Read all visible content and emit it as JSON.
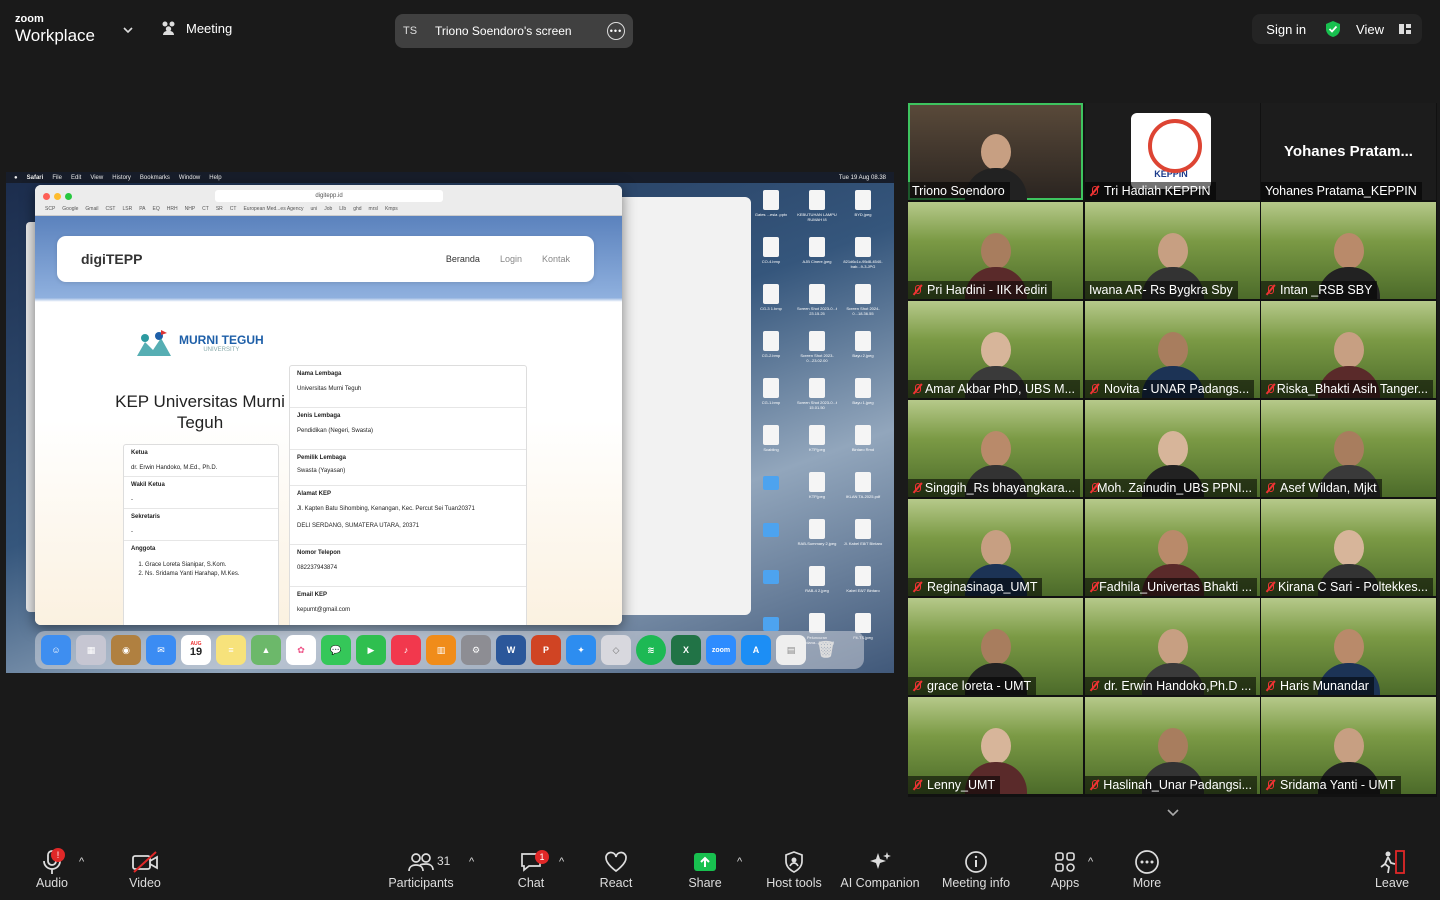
{
  "topbar": {
    "logo_line1": "zoom",
    "logo_line2": "Workplace",
    "meeting_label": "Meeting",
    "share_initials": "TS",
    "share_title": "Triono Soendoro's screen",
    "sign_in": "Sign in",
    "view": "View"
  },
  "shared_screen": {
    "menubar": [
      "Safari",
      "File",
      "Edit",
      "View",
      "History",
      "Bookmarks",
      "Window",
      "Help"
    ],
    "clock": "Tue 19 Aug 08.38",
    "url": "digitepp.id",
    "bookmarks": [
      "SCP",
      "Google",
      "Gmail",
      "CST",
      "LSR",
      "PA",
      "EQ",
      "HRH",
      "NHP",
      "CT",
      "SR",
      "CT",
      "European Med...es Agency",
      "uni",
      "Job",
      "LIb",
      "ghd",
      "mrsl",
      "Kmps"
    ],
    "site": {
      "brand": "digiTEPP",
      "nav": [
        "Beranda",
        "Login",
        "Kontak"
      ],
      "org_logo": "MURNI TEGUH",
      "org_logo_sub": "UNIVERSITY",
      "title": "KEP Universitas Murni Teguh",
      "left_fields": [
        {
          "k": "Ketua",
          "v": "dr. Erwin Handoko, M.Ed., Ph.D."
        },
        {
          "k": "Wakil Ketua",
          "v": "-"
        },
        {
          "k": "Sekretaris",
          "v": "-"
        }
      ],
      "anggota_label": "Anggota",
      "anggota": [
        "Grace Loreta Sianipar, S.Kom.",
        "Ns. Sridama Yanti Harahap, M.Kes."
      ],
      "right_fields": [
        {
          "k": "Nama Lembaga",
          "v": "Universitas Murni Teguh"
        },
        {
          "k": "Jenis Lembaga",
          "v": "Pendidikan (Negeri, Swasta)"
        },
        {
          "k": "Pemilik Lembaga",
          "v": "Swasta (Yayasan)"
        },
        {
          "k": "Alamat KEP",
          "v": "Jl. Kapten Batu Sihombing, Kenangan, Kec. Percut Sei Tuan20371",
          "v2": "DELI SERDANG, SUMATERA UTARA, 20371"
        },
        {
          "k": "Nomor Telepon",
          "v": "082237943874"
        },
        {
          "k": "Email KEP",
          "v": "kepumt@gmail.com"
        }
      ]
    },
    "desktop_icons": [
      "Gates ...esia .pptx",
      "KEBUTUHAN LAMPU RUMAH I8",
      "BYD.jpeg",
      "CO-4.bmp",
      "AJB Cinere.jpeg",
      "821d6c1c-95d8-4540-bab...9-3.JPG",
      "CG-3 1.bmp",
      "Screen Shot 2023-0...t 23.15.25",
      "Screen Shot 2024-0...18.36.55",
      "CG-2.bmp",
      "Screen Shot 2023-0...23.02.00",
      "Bayu 2.jpeg",
      "CG-1.bmp",
      "Screen Shot 2023-0...t 15.01.50",
      "Bayu 1.jpeg",
      "Scabling",
      "KTP.jpeg",
      "Bintaro Rmd",
      "",
      "KTP.jpeg",
      "IKLAN TA-2025.pdf",
      "",
      "RAB-Summary 2.jpeg",
      "Jl. Kabel E8/7 Bintaro",
      "",
      "RAB-4 2.jpeg",
      "Kabel E8/7 Bintaro",
      "",
      "Peluncuran Perdana...2022.pdf",
      "Fit-TS.jpeg"
    ],
    "dock_date": "19",
    "dock_month": "AUG"
  },
  "gallery": {
    "tiles": [
      {
        "name": "Triono Soendoro",
        "muted": false,
        "active": true
      },
      {
        "name": "Tri Hadiah KEPPIN",
        "muted": true,
        "logo": "KEPPIN"
      },
      {
        "name": "Yohanes Pratama_KEPPIN",
        "muted": false,
        "bigname": "Yohanes  Pratam..."
      },
      {
        "name": "Pri Hardini - IIK Kediri",
        "muted": true
      },
      {
        "name": "Iwana AR- Rs Bygkra Sby",
        "muted": false
      },
      {
        "name": "Intan _RSB SBY",
        "muted": true
      },
      {
        "name": "Amar Akbar PhD, UBS M...",
        "muted": true
      },
      {
        "name": "Novita - UNAR Padangs...",
        "muted": true
      },
      {
        "name": "Riska_Bhakti Asih Tanger...",
        "muted": true
      },
      {
        "name": "Singgih_Rs bhayangkara...",
        "muted": true
      },
      {
        "name": "Moh. Zainudin_UBS PPNI...",
        "muted": true
      },
      {
        "name": "Asef Wildan, Mjkt",
        "muted": true
      },
      {
        "name": "Reginasinaga_UMT",
        "muted": true
      },
      {
        "name": "Fadhila_Univertas Bhakti ...",
        "muted": true
      },
      {
        "name": "Kirana C Sari - Poltekkes...",
        "muted": true
      },
      {
        "name": "grace loreta - UMT",
        "muted": true
      },
      {
        "name": "dr. Erwin Handoko,Ph.D ...",
        "muted": true
      },
      {
        "name": "Haris Munandar",
        "muted": true
      },
      {
        "name": "Lenny_UMT",
        "muted": true
      },
      {
        "name": "Haslinah_Unar Padangsi...",
        "muted": true
      },
      {
        "name": "Sridama Yanti - UMT",
        "muted": true
      }
    ]
  },
  "toolbar": {
    "audio": "Audio",
    "audio_badge": "!",
    "video": "Video",
    "participants": "Participants",
    "participants_count": "31",
    "chat": "Chat",
    "chat_badge": "1",
    "react": "React",
    "share": "Share",
    "host_tools": "Host tools",
    "ai_companion": "AI Companion",
    "meeting_info": "Meeting info",
    "apps": "Apps",
    "more": "More",
    "leave": "Leave"
  },
  "colors": {
    "accent_green": "#3ec45f",
    "share_green": "#18c04f",
    "alert_red": "#e02828",
    "tile_bg": "#7b9a45"
  }
}
